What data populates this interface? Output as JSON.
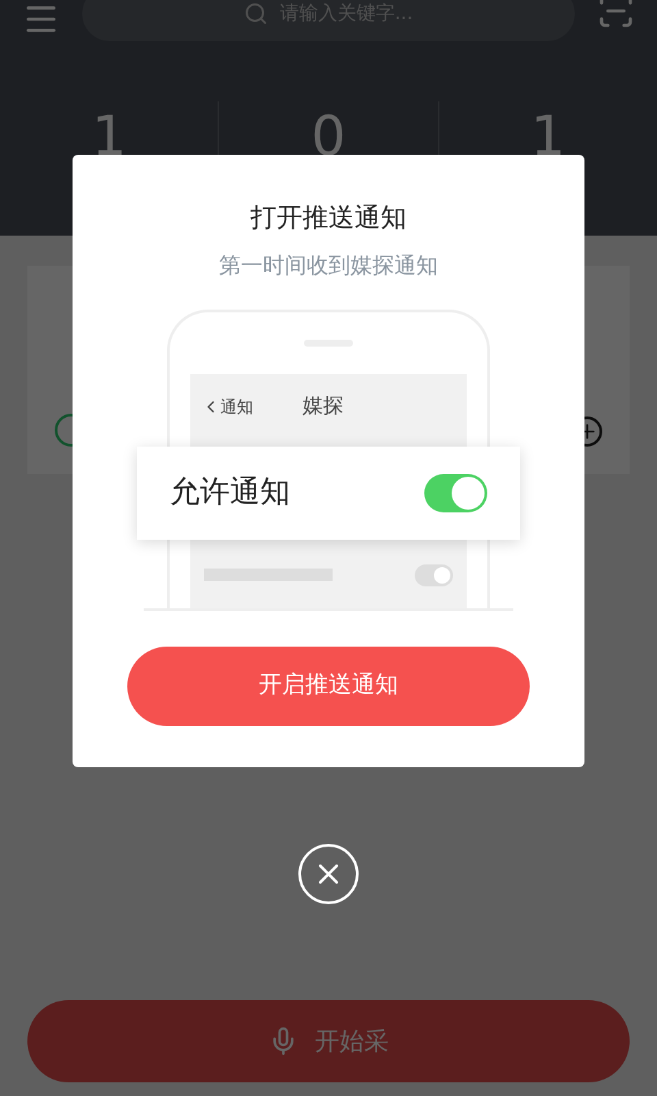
{
  "header": {
    "search": {
      "placeholder": "请输入关键字..."
    },
    "stats": [
      "1",
      "0",
      "1"
    ]
  },
  "dialog": {
    "title": "打开推送通知",
    "subtitle": "第一时间收到媒探通知",
    "illustration": {
      "back": "通知",
      "screen_title": "媒探",
      "setting": {
        "label": "允许通知",
        "on": true
      }
    },
    "button": "开启推送通知"
  },
  "record_button": "开始采"
}
